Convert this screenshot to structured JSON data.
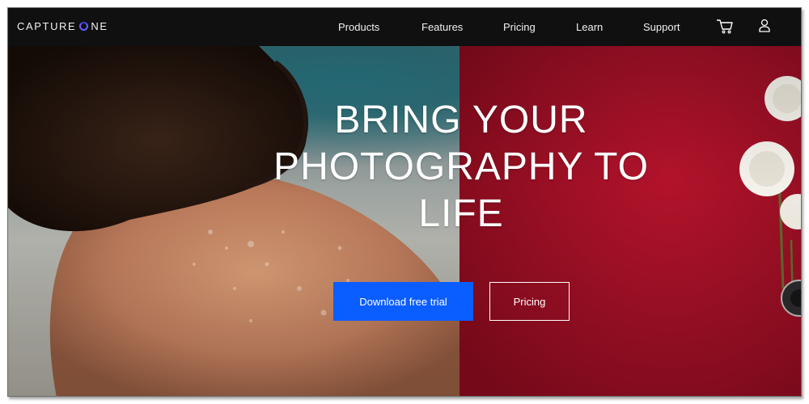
{
  "brand": {
    "logo_part1": "CAPTURE",
    "logo_part2": "NE",
    "accent_color": "#5a63ff"
  },
  "nav": {
    "items": [
      {
        "label": "Products"
      },
      {
        "label": "Features"
      },
      {
        "label": "Pricing"
      },
      {
        "label": "Learn"
      },
      {
        "label": "Support"
      }
    ],
    "icons": [
      "cart-icon",
      "user-icon"
    ]
  },
  "hero": {
    "title": "BRING YOUR PHOTOGRAPHY TO LIFE",
    "primary_button": "Download free trial",
    "secondary_button": "Pricing",
    "primary_color": "#0a5dff",
    "background_left": "#8b9696",
    "background_right": "#9a0f24"
  }
}
